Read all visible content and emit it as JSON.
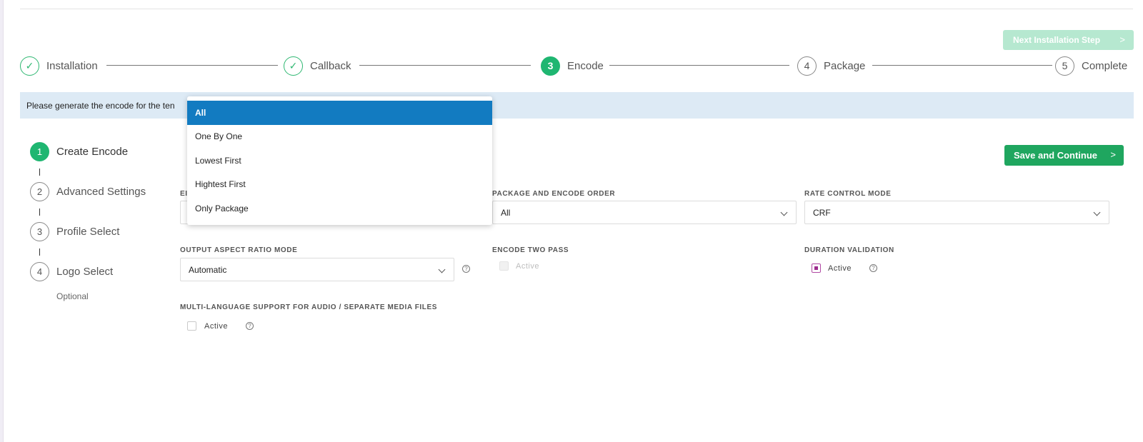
{
  "header": {
    "next_step_label": "Next Installation Step",
    "next_icon": "chevron-right-icon"
  },
  "stepper": {
    "steps": [
      {
        "label": "Installation",
        "state": "done",
        "marker": "✓"
      },
      {
        "label": "Callback",
        "state": "done",
        "marker": "✓"
      },
      {
        "label": "Encode",
        "state": "active",
        "marker": "3"
      },
      {
        "label": "Package",
        "state": "pending",
        "marker": "4"
      },
      {
        "label": "Complete",
        "state": "pending",
        "marker": "5"
      }
    ]
  },
  "banner": {
    "text": "Please generate the encode for the ten"
  },
  "side_steps": {
    "items": [
      {
        "number": "1",
        "label": "Create Encode",
        "state": "active"
      },
      {
        "number": "2",
        "label": "Advanced Settings",
        "state": "pending"
      },
      {
        "number": "3",
        "label": "Profile Select",
        "state": "pending"
      },
      {
        "number": "4",
        "label": "Logo Select",
        "state": "pending"
      }
    ],
    "optional_label": "Optional"
  },
  "save_button": {
    "label": "Save and Continue"
  },
  "form": {
    "encode_field_label_partial": "EI",
    "package_order": {
      "label": "PACKAGE AND ENCODE ORDER",
      "value": "All"
    },
    "rate_control": {
      "label": "RATE CONTROL MODE",
      "value": "CRF"
    },
    "aspect_ratio": {
      "label": "OUTPUT ASPECT RATIO MODE",
      "value": "Automatic"
    },
    "two_pass": {
      "label": "ENCODE TWO PASS",
      "checkbox_label": "Active",
      "checked": false,
      "disabled": true
    },
    "duration_validation": {
      "label": "DURATION VALIDATION",
      "checkbox_label": "Active",
      "checked": true
    },
    "multi_language": {
      "label": "MULTI-LANGUAGE SUPPORT FOR AUDIO / SEPARATE MEDIA FILES",
      "checkbox_label": "Active",
      "checked": false
    },
    "help_glyph": "?"
  },
  "dropdown": {
    "options": [
      "All",
      "One By One",
      "Lowest First",
      "Hightest First",
      "Only Package"
    ],
    "selected": "All"
  },
  "colors": {
    "accent_green": "#1fb671",
    "save_green": "#1fa65f",
    "next_disabled": "#b6e8d0",
    "banner_bg": "#ddeaf5",
    "dropdown_selected": "#127bc1",
    "checkbox_purple": "#9c2b8e"
  }
}
